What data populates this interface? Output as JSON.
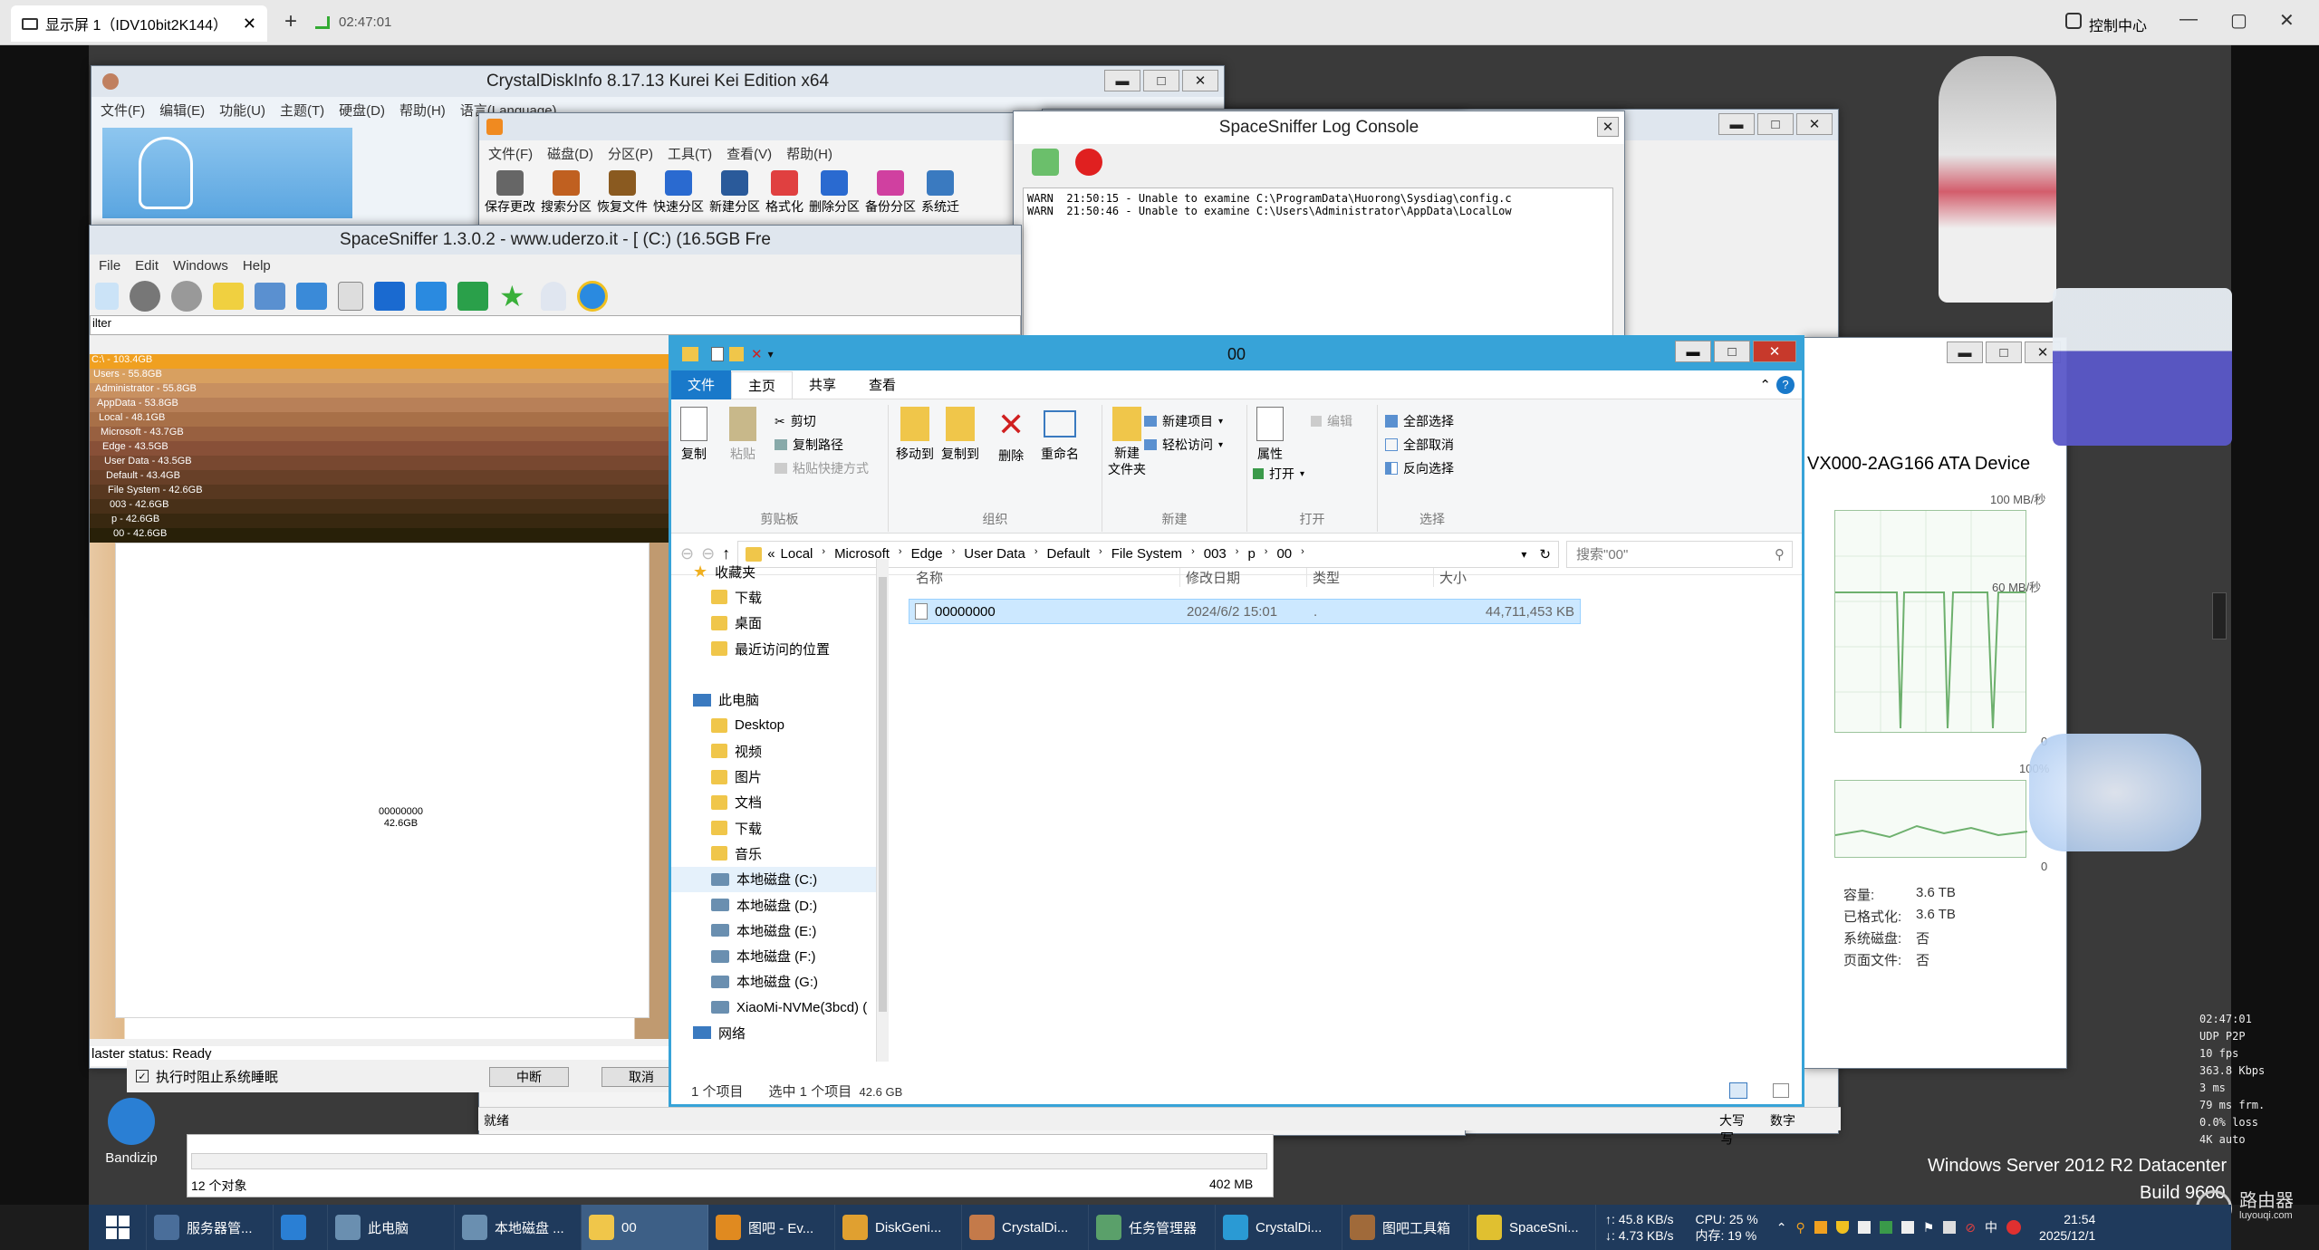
{
  "host": {
    "tab_title": "显示屏 1（IDV10bit2K144）",
    "add_tab": "+",
    "time": "02:47:01",
    "control_center": "控制中心"
  },
  "crystaldisk": {
    "title": "CrystalDiskInfo 8.17.13 Kurei Kei Edition x64",
    "menu": [
      "文件(F)",
      "编辑(E)",
      "功能(U)",
      "主题(T)",
      "硬盘(D)",
      "帮助(H)",
      "语言(Language)"
    ]
  },
  "diskgenius": {
    "menu": [
      "文件(F)",
      "磁盘(D)",
      "分区(P)",
      "工具(T)",
      "查看(V)",
      "帮助(H)"
    ],
    "toolbar": [
      "保存更改",
      "搜索分区",
      "恢复文件",
      "快速分区",
      "新建分区",
      "格式化",
      "删除分区",
      "备份分区",
      "系统迁"
    ]
  },
  "spacesniffer": {
    "title": "SpaceSniffer 1.3.0.2 - www.uderzo.it - [ (C:) (16.5GB Fre",
    "menu": [
      "File",
      "Edit",
      "Windows",
      "Help"
    ],
    "filter": "ilter",
    "tree": [
      "C:\\ - 103.4GB",
      "Users - 55.8GB",
      "Administrator - 55.8GB",
      "AppData - 53.8GB",
      "Local - 48.1GB",
      "Microsoft - 43.7GB",
      "Edge - 43.5GB",
      "User Data - 43.5GB",
      "Default - 43.4GB",
      "File System - 42.6GB",
      "003 - 42.6GB",
      "p - 42.6GB",
      "00 - 42.6GB"
    ],
    "block_name": "00000000",
    "block_size": "42.6GB",
    "status": "laster status: Ready",
    "tree_colors": [
      "#f0a020",
      "#d8a060",
      "#c89060",
      "#b88058",
      "#a87048",
      "#986040",
      "#885038",
      "#784830",
      "#684028",
      "#583820",
      "#483018",
      "#382810",
      "#282008"
    ]
  },
  "logconsole": {
    "title": "SpaceSniffer Log Console",
    "lines": [
      "WARN  21:50:15 - Unable to examine C:\\ProgramData\\Huorong\\Sysdiag\\config.c",
      "WARN  21:50:46 - Unable to examine C:\\Users\\Administrator\\AppData\\LocalLow"
    ]
  },
  "bottomdlg": {
    "checkbox": "执行时阻止系统睡眠",
    "btn_interrupt": "中断",
    "btn_cancel": "取消",
    "ready": "就绪",
    "caps": "大写",
    "num": "数字",
    "objects": "12 个对象",
    "size": "402 MB"
  },
  "taskmgr": {
    "device": "VX000-2AG166 ATA Device",
    "speed_max": "100 MB/秒",
    "speed_mid": "60 MB/秒",
    "zero": "0",
    "pct": "100%",
    "props": [
      {
        "k": "容量:",
        "v": "3.6 TB"
      },
      {
        "k": "已格式化:",
        "v": "3.6 TB"
      },
      {
        "k": "系统磁盘:",
        "v": "否"
      },
      {
        "k": "页面文件:",
        "v": "否"
      }
    ]
  },
  "explorer": {
    "title": "00",
    "tabs": [
      "文件",
      "主页",
      "共享",
      "查看"
    ],
    "ribbon": {
      "copy": "复制",
      "paste": "粘贴",
      "cut": "剪切",
      "copy_path": "复制路径",
      "paste_shortcut": "粘贴快捷方式",
      "clipboard": "剪贴板",
      "move_to": "移动到",
      "copy_to": "复制到",
      "delete": "删除",
      "rename": "重命名",
      "organize": "组织",
      "new_folder": "新建\n文件夹",
      "new_item": "新建项目",
      "easy_access": "轻松访问",
      "new": "新建",
      "properties": "属性",
      "open": "打开",
      "edit": "编辑",
      "open_grp": "打开",
      "select_all": "全部选择",
      "select_none": "全部取消",
      "invert": "反向选择",
      "select": "选择"
    },
    "path": [
      "Local",
      "Microsoft",
      "Edge",
      "User Data",
      "Default",
      "File System",
      "003",
      "p",
      "00"
    ],
    "path_prefix": "«",
    "search_placeholder": "搜索\"00\"",
    "nav": [
      {
        "label": "收藏夹",
        "top": true,
        "icon": "star"
      },
      {
        "label": "下载",
        "icon": "folder"
      },
      {
        "label": "桌面",
        "icon": "folder"
      },
      {
        "label": "最近访问的位置",
        "icon": "folder"
      },
      {
        "label": "",
        "icon": "none"
      },
      {
        "label": "此电脑",
        "top": true,
        "icon": "pc"
      },
      {
        "label": "Desktop",
        "icon": "folder"
      },
      {
        "label": "视频",
        "icon": "folder"
      },
      {
        "label": "图片",
        "icon": "folder"
      },
      {
        "label": "文档",
        "icon": "folder"
      },
      {
        "label": "下载",
        "icon": "folder"
      },
      {
        "label": "音乐",
        "icon": "folder"
      },
      {
        "label": "本地磁盘 (C:)",
        "icon": "drive",
        "sel": true
      },
      {
        "label": "本地磁盘 (D:)",
        "icon": "drive"
      },
      {
        "label": "本地磁盘 (E:)",
        "icon": "drive"
      },
      {
        "label": "本地磁盘 (F:)",
        "icon": "drive"
      },
      {
        "label": "本地磁盘 (G:)",
        "icon": "drive"
      },
      {
        "label": "XiaoMi-NVMe(3bcd) (",
        "icon": "drive"
      },
      {
        "label": "网络",
        "top": true,
        "icon": "net"
      }
    ],
    "columns": [
      "名称",
      "修改日期",
      "类型",
      "大小"
    ],
    "files": [
      {
        "name": "00000000",
        "date": "2024/6/2 15:01",
        "type": ".",
        "size": "44,711,453 KB"
      }
    ],
    "status_count": "1 个项目",
    "status_sel": "选中 1 个项目",
    "status_size": "42.6 GB"
  },
  "overlay": {
    "stats": [
      "02:47:01",
      "UDP P2P",
      "10 fps",
      "363.8 Kbps",
      "3 ms",
      "79 ms frm.",
      "0.0% loss",
      "4K auto"
    ],
    "watermark1": "Windows Server 2012 R2 Datacenter",
    "watermark2": "Build 9600",
    "brand": "路由器",
    "brand_url": "luyouqi.com"
  },
  "desktop_icon": "Bandizip",
  "taskbar": {
    "items": [
      {
        "label": "服务器管...",
        "color": "#4a6e9a"
      },
      {
        "label": "",
        "color": "#2a7fd4"
      },
      {
        "label": "此电脑",
        "color": "#6a8fb0"
      },
      {
        "label": "本地磁盘 ...",
        "color": "#6a8fb0"
      },
      {
        "label": "00",
        "color": "#f0c64a",
        "active": true
      },
      {
        "label": "图吧 - Ev...",
        "color": "#e08a20"
      },
      {
        "label": "DiskGeni...",
        "color": "#e0a030"
      },
      {
        "label": "CrystalDi...",
        "color": "#c47a4a"
      },
      {
        "label": "任务管理器",
        "color": "#5aa06a"
      },
      {
        "label": "CrystalDi...",
        "color": "#2a9ad4"
      },
      {
        "label": "图吧工具箱",
        "color": "#a06a3a"
      },
      {
        "label": "SpaceSni...",
        "color": "#e0c030"
      }
    ],
    "net_up": "↑: 45.8 KB/s",
    "net_down": "↓: 4.73 KB/s",
    "cpu": "CPU: 25 %",
    "mem": "内存: 19 %",
    "ime": "中",
    "clock_time": "21:54",
    "clock_date": "2025/12/1"
  }
}
